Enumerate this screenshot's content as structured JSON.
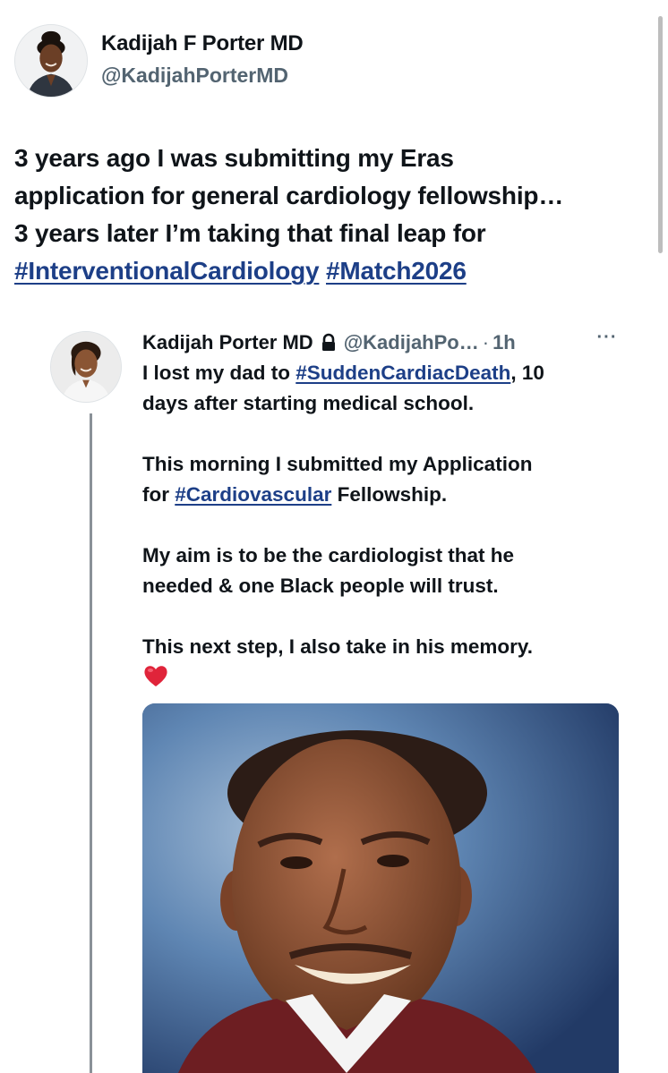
{
  "tweet": {
    "author": {
      "name": "Kadijah F Porter MD",
      "handle": "@KadijahPorterMD"
    },
    "text_lines": [
      "3 years ago I was submitting my Eras",
      "application for general cardiology fellowship…",
      "3 years later I’m taking that final leap for"
    ],
    "hashtags": [
      "#InterventionalCardiology",
      "#Match2026"
    ]
  },
  "quoted": {
    "name": "Kadijah Porter MD",
    "handle": "@KadijahPo…",
    "separator": "·",
    "time": "1h",
    "more_label": "···",
    "p1": {
      "pre": "I lost my dad to ",
      "hashtag": "#SuddenCardiacDeath",
      "post": ", 10",
      "line2": "days after starting medical school."
    },
    "p2": {
      "line1": "This morning I submitted my Application",
      "pre": "for ",
      "hashtag": "#Cardiovascular",
      "post": " Fellowship."
    },
    "p3": {
      "line1": "My aim is to be the cardiologist that he",
      "line2": "needed & one Black people will trust."
    },
    "p4": {
      "line1": "This next step, I also take in his memory."
    },
    "emoji": "heart-emoji",
    "photo": "portrait-photo"
  },
  "colors": {
    "hashtag": "#1d3f87",
    "secondary_text": "#536471",
    "heart": "#e0243a"
  }
}
